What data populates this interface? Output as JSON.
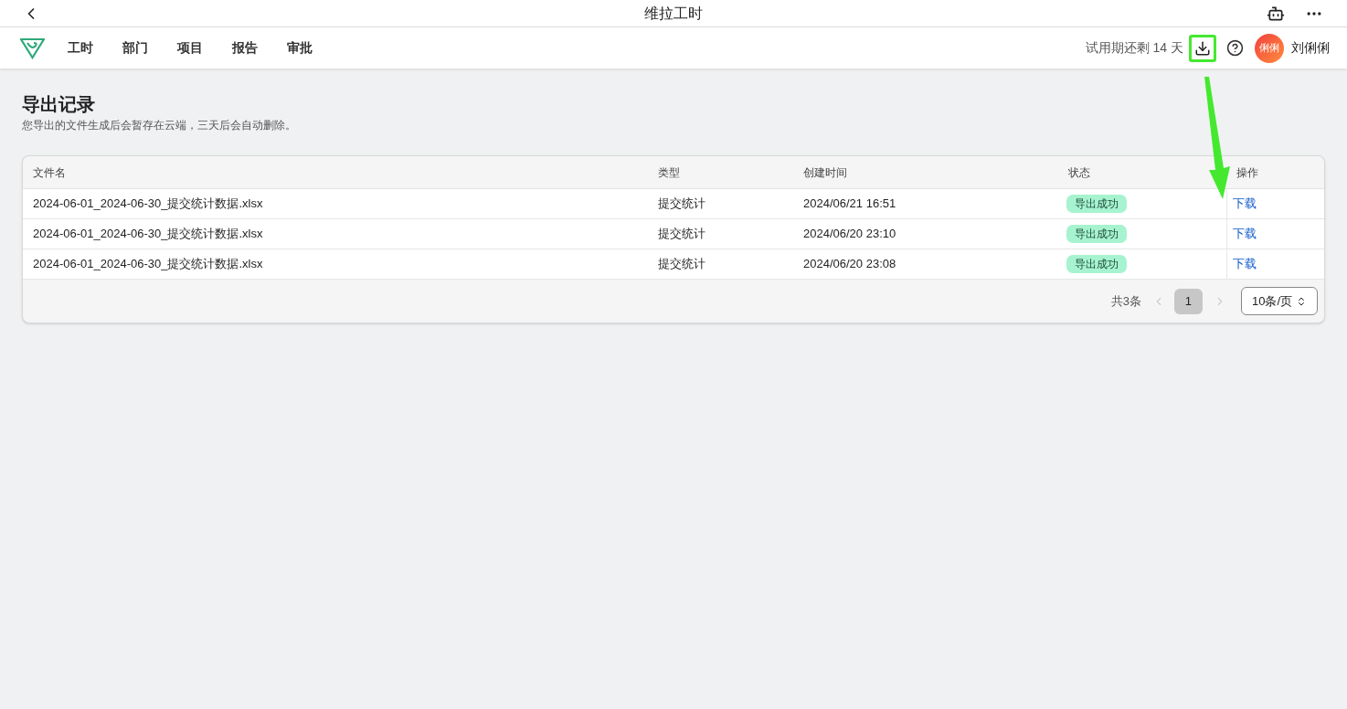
{
  "window": {
    "title": "维拉工时"
  },
  "nav": {
    "items": [
      {
        "label": "工时",
        "selected": false
      },
      {
        "label": "部门",
        "selected": false
      },
      {
        "label": "项目",
        "selected": false
      },
      {
        "label": "报告",
        "selected": false
      },
      {
        "label": "审批",
        "selected": false
      }
    ],
    "trial": "试用期还剩 14 天",
    "download_highlighted": true,
    "avatar": "俐俐",
    "user": "刘俐俐"
  },
  "page": {
    "title": "导出记录",
    "subtitle": "您导出的文件生成后会暂存在云端，三天后会自动删除。"
  },
  "table": {
    "columns": [
      "文件名",
      "类型",
      "创建时间",
      "状态",
      "操作"
    ],
    "rows": [
      {
        "file": "2024-06-01_2024-06-30_提交统计数据.xlsx",
        "type": "提交统计",
        "created": "2024/06/21 16:51",
        "status": "导出成功",
        "action": "下载"
      },
      {
        "file": "2024-06-01_2024-06-30_提交统计数据.xlsx",
        "type": "提交统计",
        "created": "2024/06/20 23:10",
        "status": "导出成功",
        "action": "下载"
      },
      {
        "file": "2024-06-01_2024-06-30_提交统计数据.xlsx",
        "type": "提交统计",
        "created": "2024/06/20 23:08",
        "status": "导出成功",
        "action": "下载"
      }
    ]
  },
  "pagination": {
    "total": "共3条",
    "pages": [
      {
        "label": "1",
        "selected": true
      }
    ],
    "page_size": "10条/页"
  }
}
